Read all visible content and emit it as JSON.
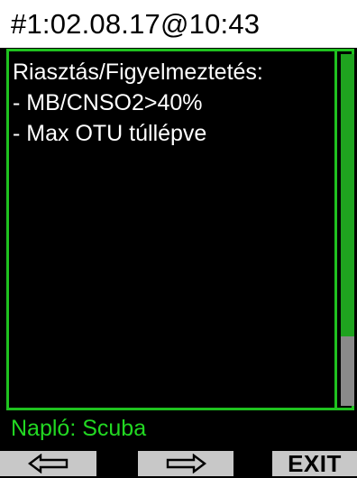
{
  "header": {
    "title": "#1:02.08.17@10:43"
  },
  "panel": {
    "lines": [
      "Riasztás/Figyelmeztetés:",
      "- MB/CNSO2>40%",
      "- Max OTU túllépve"
    ]
  },
  "footer": {
    "label": "Napló: Scuba"
  },
  "softkeys": {
    "left_icon": "left-arrow-icon",
    "middle_icon": "right-arrow-icon",
    "right_label": "EXIT"
  },
  "colors": {
    "accent_green": "#1fc21f",
    "footer_text_green": "#22d822",
    "softkey_gray": "#c8c8c8"
  }
}
